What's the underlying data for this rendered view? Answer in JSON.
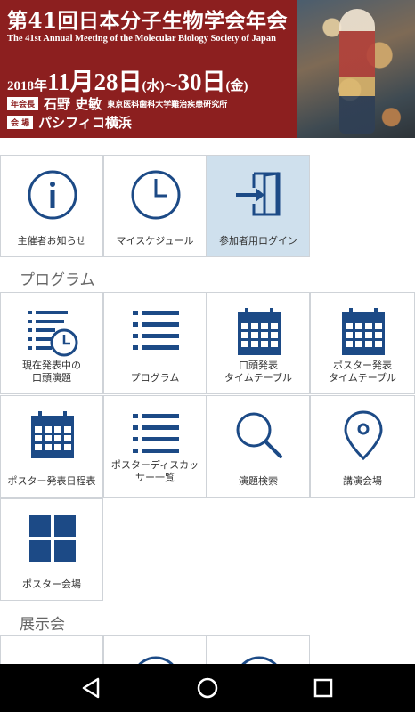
{
  "banner": {
    "title": "第41回日本分子生物学会年会",
    "subtitle": "The 41st Annual Meeting of the Molecular Biology Society of Japan",
    "date_year": "2018年",
    "date_start": "11月28日",
    "date_start_dow": "(水)",
    "date_sep": "～",
    "date_end": "30日",
    "date_end_dow": "(金)",
    "president_tag": "年会長",
    "president_name": "石野 史敏",
    "president_affiliation": "東京医科歯科大学難治疾患研究所",
    "venue_tag": "会 場",
    "venue_name": "パシフィコ横浜"
  },
  "top_tiles": [
    {
      "label": "主催者お知らせ",
      "icon": "info-icon"
    },
    {
      "label": "マイスケジュール",
      "icon": "clock-icon"
    },
    {
      "label": "参加者用ログイン",
      "icon": "login-icon"
    }
  ],
  "program_section": {
    "title": "プログラム",
    "tiles": [
      {
        "label": "現在発表中の\n口頭演題",
        "icon": "list-clock-icon"
      },
      {
        "label": "プログラム",
        "icon": "list-icon"
      },
      {
        "label": "口頭発表\nタイムテーブル",
        "icon": "calendar-icon"
      },
      {
        "label": "ポスター発表\nタイムテーブル",
        "icon": "calendar-icon"
      },
      {
        "label": "ポスター発表日程表",
        "icon": "calendar-icon"
      },
      {
        "label": "ポスターディスカッ\nサー一覧",
        "icon": "list-icon"
      },
      {
        "label": "演題検索",
        "icon": "search-icon"
      },
      {
        "label": "講演会場",
        "icon": "map-pin-icon"
      },
      {
        "label": "ポスター会場",
        "icon": "grid-icon"
      }
    ]
  },
  "exhibit_section": {
    "title": "展示会"
  },
  "navbar": {
    "back": "back-icon",
    "home": "home-icon",
    "recents": "recents-icon"
  },
  "colors": {
    "banner_bg": "#8c1f1f",
    "icon": "#1c4a86",
    "highlight_tile": "#cfe0ed",
    "tile_border": "#cfd3d8"
  }
}
